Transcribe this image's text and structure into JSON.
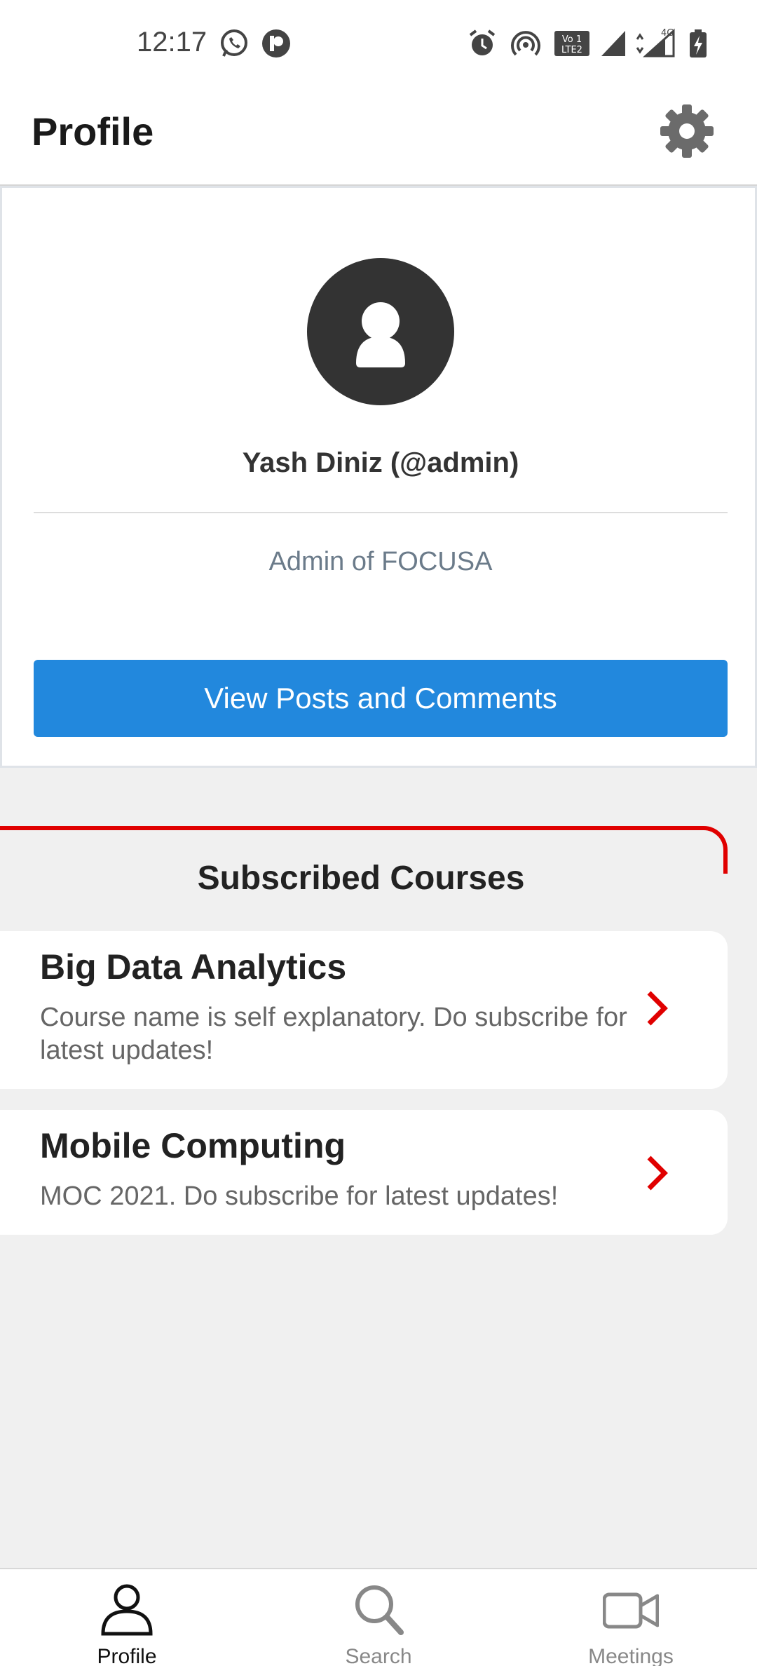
{
  "status_bar": {
    "time": "12:17",
    "icons": [
      "whatsapp-icon",
      "app-notification-icon",
      "alarm-icon",
      "hotspot-icon",
      "volte-icon",
      "signal-icon",
      "signal-4g-icon",
      "battery-charging-icon"
    ],
    "network_label": "4G",
    "volte_label": "LTE 2"
  },
  "app_bar": {
    "title": "Profile",
    "settings_icon": "gear-icon"
  },
  "profile": {
    "name": "Yash Diniz (@admin)",
    "role": "Admin of FOCUSA",
    "button_label": "View Posts and Comments",
    "avatar_icon": "user-icon"
  },
  "courses": {
    "section_title": "Subscribed Courses",
    "accent_color": "#e00000",
    "items": [
      {
        "title": "Big Data Analytics",
        "description": "Course name is self explanatory. Do subscribe for latest updates!"
      },
      {
        "title": "Mobile Computing",
        "description": "MOC 2021. Do subscribe for latest updates!"
      }
    ]
  },
  "bottom_nav": {
    "items": [
      {
        "label": "Profile",
        "icon": "person-icon",
        "active": true
      },
      {
        "label": "Search",
        "icon": "search-icon",
        "active": false
      },
      {
        "label": "Meetings",
        "icon": "video-camera-icon",
        "active": false
      }
    ]
  },
  "colors": {
    "primary_button": "#2288dd",
    "accent": "#e00000",
    "background": "#f0f0f0",
    "nav_active": "#111111",
    "nav_inactive": "#888888"
  }
}
